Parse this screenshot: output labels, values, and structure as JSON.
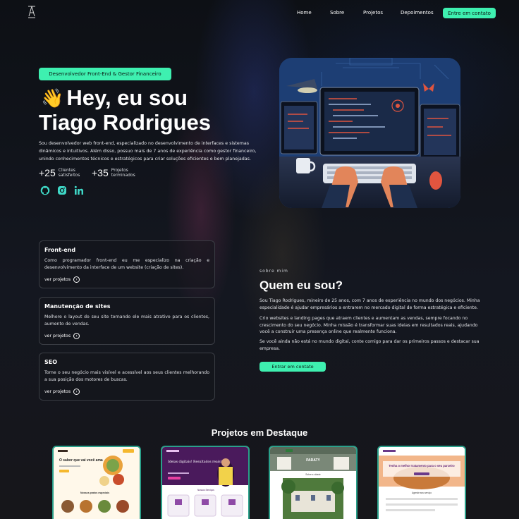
{
  "nav": {
    "logo": "logo-icon",
    "items": [
      "Home",
      "Sobre",
      "Projetos",
      "Depoimentos"
    ],
    "cta": "Entre em contato"
  },
  "hero": {
    "badge": "Desenvolvedor Front-End & Gestor Financeiro",
    "wave_icon": "waving-hand-icon",
    "greeting": "Hey, eu sou",
    "name": "Tiago Rodrigues",
    "description": "Sou desenvolvedor web front-end, especializado no desenvolvimento de interfaces e sistemas dinâmicos e intuitivos. Além disso, possuo mais de 7 anos de experiência como gestor financeiro, unindo conhecimentos técnicos e estratégicos para criar soluções eficientes e bem planejadas.",
    "stats": [
      {
        "value": "+25",
        "label": "Clientes satisfeitos"
      },
      {
        "value": "+35",
        "label": "Projetos terminados"
      }
    ],
    "social": [
      "github-icon",
      "instagram-icon",
      "linkedin-icon"
    ]
  },
  "services": [
    {
      "title": "Front-end",
      "text": "Como programador front-end eu me especializo na criação e desenvolvimento da interface de um website (criação de sites).",
      "link": "ver projetos"
    },
    {
      "title": "Manutenção de sites",
      "text": "Melhore o layout do seu site tornando ele mais atrativo para os clientes, aumento de vendas.",
      "link": "ver projetos"
    },
    {
      "title": "SEO",
      "text": "Torne o seu negócio mais visível e acessível aos seus clientes melhorando a sua posição dos motores de buscas.",
      "link": "ver projetos"
    }
  ],
  "about": {
    "kicker": "sobre mim",
    "title": "Quem eu sou?",
    "paragraphs": [
      "Sou Tiago Rodrigues, mineiro de 25 anos, com 7 anos de experiência no mundo dos negócios. Minha especialidade é ajudar empresários a entrarem no mercado digital de forma estratégica e eficiente.",
      "Crio websites e landing pages que atraem clientes e aumentam as vendas, sempre focando no crescimento do seu negócio. Minha missão é transformar suas ideias em resultados reais, ajudando você a construir uma presença online que realmente funciona.",
      "Se você ainda não está no mundo digital, conte comigo para dar os primeiros passos e destacar sua empresa."
    ],
    "cta": "Entrar em contato"
  },
  "projects": {
    "title": "Projetos em Destaque",
    "items": [
      {
        "headline": "O sabor que vai você ama",
        "section": "Nossos pratos especiais"
      },
      {
        "headline": "Ideias digitais! Resultados reais!",
        "section": "Nossos Serviços"
      },
      {
        "headline": "PARATY",
        "section": "Sobre a cidade"
      },
      {
        "headline": "Tenha o melhor tratamento para o seu parceiro",
        "section": "Agende seu serviço"
      }
    ]
  },
  "colors": {
    "accent": "#3ef0b0",
    "background": "#0f1116",
    "project_border": "#2aa08a"
  }
}
